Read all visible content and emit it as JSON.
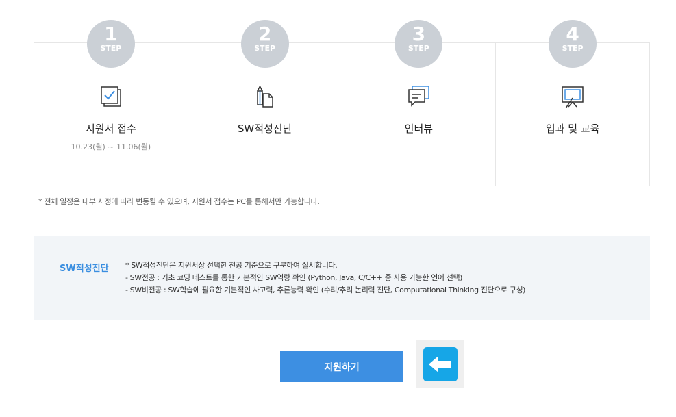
{
  "steps": [
    {
      "num": "1",
      "label": "STEP",
      "title": "지원서 접수",
      "date": "10.23(월) ~ 11.06(월)",
      "icon": "checkbox-document-icon"
    },
    {
      "num": "2",
      "label": "STEP",
      "title": "SW적성진단",
      "date": "",
      "icon": "pencil-document-icon"
    },
    {
      "num": "3",
      "label": "STEP",
      "title": "인터뷰",
      "date": "",
      "icon": "speech-bubble-icon"
    },
    {
      "num": "4",
      "label": "STEP",
      "title": "입과 및 교육",
      "date": "",
      "icon": "presentation-board-icon"
    }
  ],
  "notice": "* 전체 일정은 내부 사정에 따라 변동될 수 있으며, 지원서 접수는 PC를 통해서만 가능합니다.",
  "info": {
    "title": "SW적성진단",
    "lines": [
      "* SW적성진단은 지원서상 선택한 전공 기준으로 구분하여 실시합니다.",
      "- SW전공 : 기초 코딩 테스트를 통한 기본적인 SW역량 확인 (Python, Java, C/C++ 중 사용 가능한 언어 선택)",
      "- SW비전공 : SW학습에 필요한 기본적인 사고력, 추론능력 확인 (수리/추리 논리력 진단, Computational Thinking 진단으로 구성)"
    ]
  },
  "apply_button": "지원하기",
  "colors": {
    "accent": "#3d8fe2",
    "badge": "#cbd0d6",
    "back_button": "#16a6e7",
    "info_bg": "#f2f5f8"
  }
}
